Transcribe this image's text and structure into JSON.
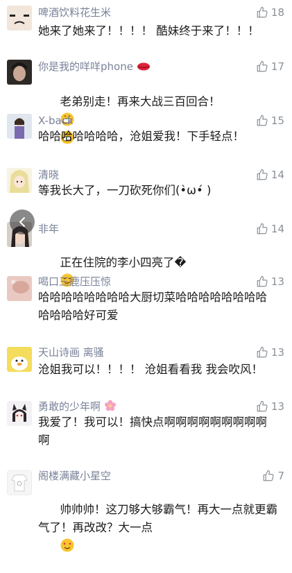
{
  "comments": [
    {
      "name": "啤酒饮料花生米",
      "likes": "18",
      "text": "她来了她来了！！！！ 酷妹终于来了！！！"
    },
    {
      "name": "你是我的咩咩phone",
      "likes": "17",
      "text": "老弟别走！再来大战三百回合！"
    },
    {
      "name": "X-back",
      "likes": "15",
      "text": "哈哈哈哈哈哈哈，沧姐爱我！下手轻点！"
    },
    {
      "name": "清晓",
      "likes": "14",
      "text": "等我长大了，一刀砍死你们(•̀ω•́ )"
    },
    {
      "name": "非年",
      "likes": "14",
      "text": "正在住院的李小四亮了�"
    },
    {
      "name": "喝口三鹿压压惊",
      "likes": "13",
      "text": "哈哈哈哈哈哈哈哈大厨切菜哈哈哈哈哈哈哈哈哈哈哈哈好可爱"
    },
    {
      "name": "天山诗画  离骚",
      "likes": "13",
      "text": "沧姐我可以！！！！ 沧姐看看我 我会吹风！"
    },
    {
      "name": "勇敢的少年啊",
      "likes": "13",
      "text": "我爱了！我可以！搞快点啊啊啊啊啊啊啊啊啊啊"
    },
    {
      "name": "阁楼满藏小星空",
      "likes": "7",
      "text": "帅帅帅！这刀够大够霸气！再大一点就更霸气了！再改改？大一点"
    }
  ]
}
